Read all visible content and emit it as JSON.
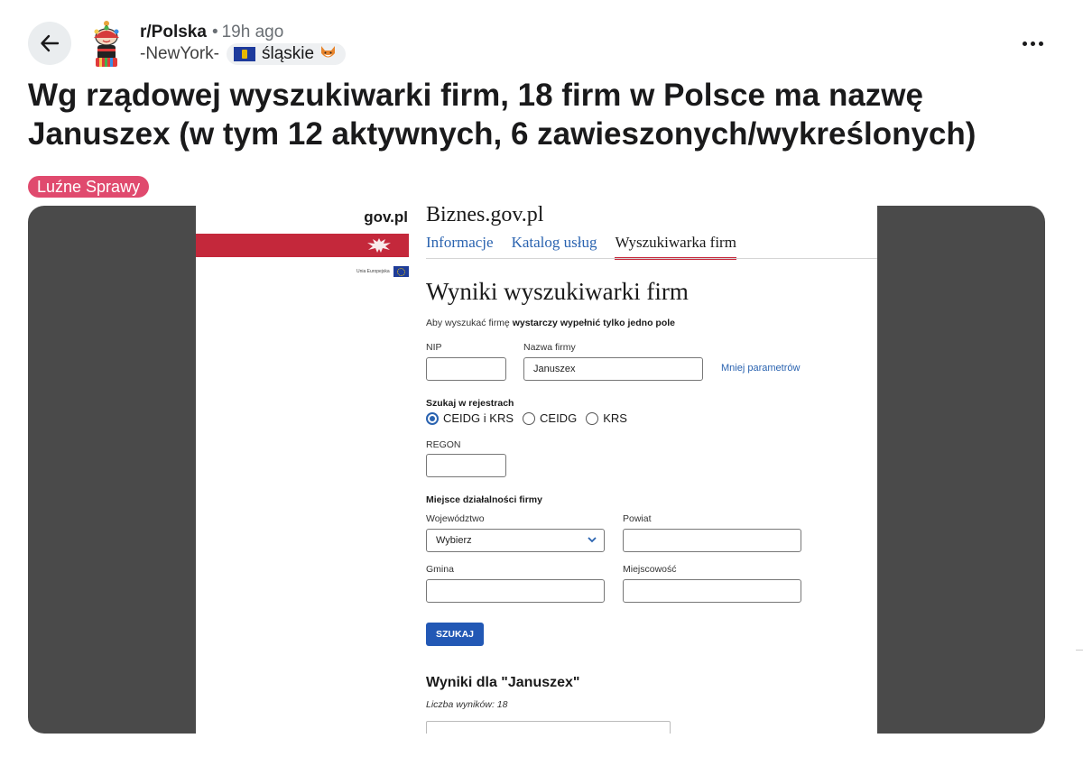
{
  "post": {
    "subreddit": "r/Polska",
    "separator": "•",
    "time": "19h ago",
    "author": "-NewYork-",
    "user_flair": "śląskie",
    "title": "Wg rządowej wyszukiwarki firm, 18 firm w Polsce ma nazwę Januszex (w tym 12 aktywnych, 6 zawieszonych/wykreślonych)",
    "flair": "Luźne Sprawy"
  },
  "icons": {
    "back": "arrow-left-icon",
    "avatar": "subreddit-avatar",
    "flag": "silesia-flag-icon",
    "fox": "fox-emoji",
    "more": "more-horizontal-icon"
  },
  "screenshot": {
    "gov_logo": "gov.pl",
    "eu_text": "Unia Europejska",
    "site_title": "Biznes.gov.pl",
    "nav": [
      "Informacje",
      "Katalog usług",
      "Wyszukiwarka firm"
    ],
    "heading": "Wyniki wyszukiwarki firm",
    "hint_normal": "Aby wyszukać firmę ",
    "hint_bold": "wystarczy wypełnić tylko jedno pole",
    "nip_label": "NIP",
    "nip_value": "",
    "name_label": "Nazwa firmy",
    "name_value": "Januszex",
    "less_params": "Mniej parametrów",
    "registers_label": "Szukaj w rejestrach",
    "radios": [
      "CEIDG i KRS",
      "CEIDG",
      "KRS"
    ],
    "radio_selected": "CEIDG i KRS",
    "regon_label": "REGON",
    "regon_value": "",
    "place_label": "Miejsce działalności firmy",
    "voivodeship_label": "Województwo",
    "voivodeship_value": "Wybierz",
    "county_label": "Powiat",
    "county_value": "",
    "commune_label": "Gmina",
    "commune_value": "",
    "town_label": "Miejscowość",
    "town_value": "",
    "search_button": "SZUKAJ",
    "results_heading": "Wyniki dla \"Januszex\"",
    "results_count": "Liczba wyników: 18"
  },
  "colors": {
    "flair_bg": "#e04a6e",
    "gov_red": "#c4283b",
    "link_blue": "#2a63b0",
    "button_blue": "#2258b5",
    "media_bg": "#4a4a4a"
  }
}
